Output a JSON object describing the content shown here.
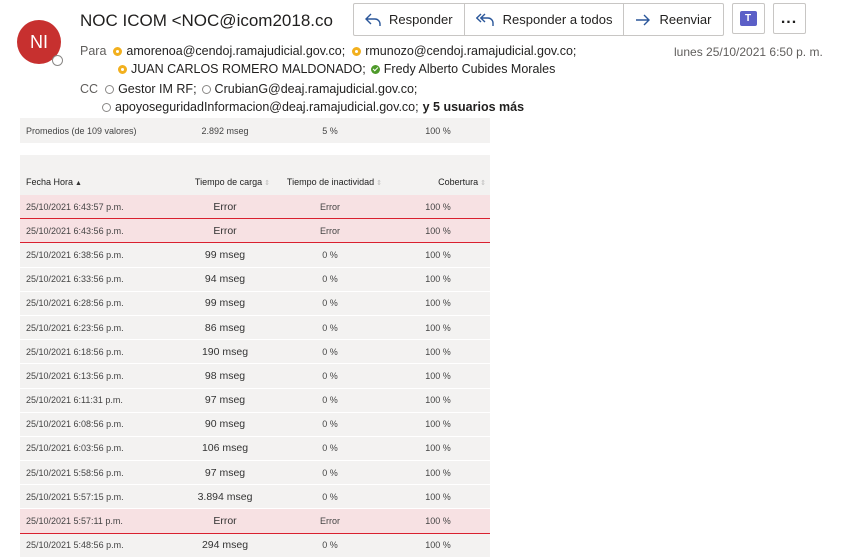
{
  "sender": {
    "initials": "NI",
    "display": "NOC ICOM <NOC@icom2018.co"
  },
  "toolbar": {
    "reply_label": "Responder",
    "reply_all_label": "Responder a todos",
    "forward_label": "Reenviar",
    "teams_icon": "T",
    "more_label": "..."
  },
  "date": "lunes 25/10/2021 6:50 p. m.",
  "recipients": {
    "to_label": "Para",
    "to": [
      "amorenoa@cendoj.ramajudicial.gov.co;",
      "rmunozo@cendoj.ramajudicial.gov.co;",
      "JUAN CARLOS ROMERO MALDONADO;",
      "Fredy Alberto Cubides Morales"
    ],
    "cc_label": "CC",
    "cc": [
      "Gestor IM RF;",
      "CrubianG@deaj.ramajudicial.gov.co;",
      "apoyoseguridadInformacion@deaj.ramajudicial.gov.co;"
    ],
    "more": "y 5 usuarios más"
  },
  "summary": {
    "label": "Promedios (de 109 valores)",
    "load": "2.892 mseg",
    "idle": "5 %",
    "coverage": "100 %"
  },
  "table": {
    "headers": {
      "date": "Fecha Hora",
      "load": "Tiempo de carga",
      "idle": "Tiempo de inactividad",
      "coverage": "Cobertura"
    },
    "rows": [
      {
        "date": "25/10/2021 6:43:57 p.m.",
        "load": "Error",
        "idle": "Error",
        "coverage": "100 %"
      },
      {
        "date": "25/10/2021 6:43:56 p.m.",
        "load": "Error",
        "idle": "Error",
        "coverage": "100 %"
      },
      {
        "date": "25/10/2021 6:38:56 p.m.",
        "load": "99 mseg",
        "idle": "0 %",
        "coverage": "100 %"
      },
      {
        "date": "25/10/2021 6:33:56 p.m.",
        "load": "94 mseg",
        "idle": "0 %",
        "coverage": "100 %"
      },
      {
        "date": "25/10/2021 6:28:56 p.m.",
        "load": "99 mseg",
        "idle": "0 %",
        "coverage": "100 %"
      },
      {
        "date": "25/10/2021 6:23:56 p.m.",
        "load": "86 mseg",
        "idle": "0 %",
        "coverage": "100 %"
      },
      {
        "date": "25/10/2021 6:18:56 p.m.",
        "load": "190 mseg",
        "idle": "0 %",
        "coverage": "100 %"
      },
      {
        "date": "25/10/2021 6:13:56 p.m.",
        "load": "98 mseg",
        "idle": "0 %",
        "coverage": "100 %"
      },
      {
        "date": "25/10/2021 6:11:31 p.m.",
        "load": "97 mseg",
        "idle": "0 %",
        "coverage": "100 %"
      },
      {
        "date": "25/10/2021 6:08:56 p.m.",
        "load": "90 mseg",
        "idle": "0 %",
        "coverage": "100 %"
      },
      {
        "date": "25/10/2021 6:03:56 p.m.",
        "load": "106 mseg",
        "idle": "0 %",
        "coverage": "100 %"
      },
      {
        "date": "25/10/2021 5:58:56 p.m.",
        "load": "97 mseg",
        "idle": "0 %",
        "coverage": "100 %"
      },
      {
        "date": "25/10/2021 5:57:15 p.m.",
        "load": "3.894 mseg",
        "idle": "0 %",
        "coverage": "100 %"
      },
      {
        "date": "25/10/2021 5:57:11 p.m.",
        "load": "Error",
        "idle": "Error",
        "coverage": "100 %"
      },
      {
        "date": "25/10/2021 5:48:56 p.m.",
        "load": "294 mseg",
        "idle": "0 %",
        "coverage": "100 %"
      }
    ]
  }
}
